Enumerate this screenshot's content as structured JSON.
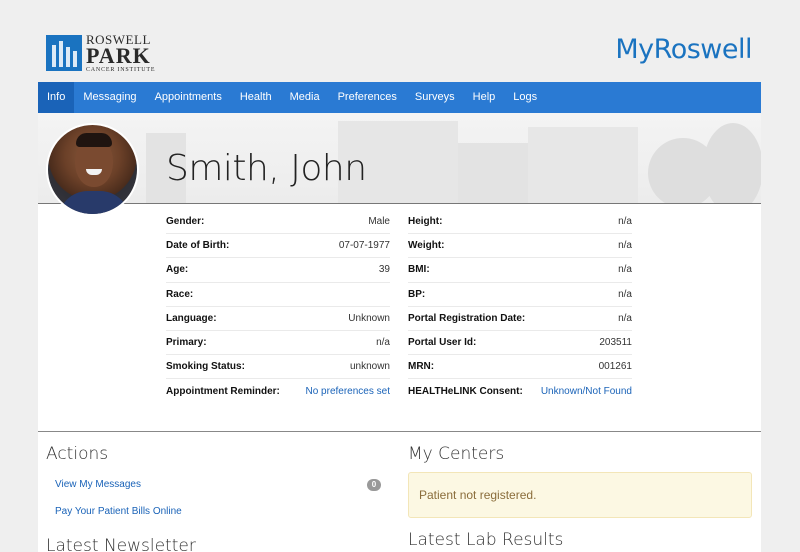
{
  "header": {
    "logo_line1": "ROSWELL",
    "logo_line2": "PARK",
    "logo_line3": "CANCER INSTITUTE",
    "brand_my": "My",
    "brand_name": "Roswell"
  },
  "nav": {
    "items": [
      {
        "label": "Info",
        "active": true
      },
      {
        "label": "Messaging"
      },
      {
        "label": "Appointments"
      },
      {
        "label": "Health"
      },
      {
        "label": "Media"
      },
      {
        "label": "Preferences"
      },
      {
        "label": "Surveys"
      },
      {
        "label": "Help"
      },
      {
        "label": "Logs"
      }
    ]
  },
  "patient": {
    "name": "Smith, John",
    "left": [
      {
        "label": "Gender:",
        "value": "Male"
      },
      {
        "label": "Date of Birth:",
        "value": "07-07-1977"
      },
      {
        "label": "Age:",
        "value": "39"
      },
      {
        "label": "Race:",
        "value": ""
      },
      {
        "label": "Language:",
        "value": "Unknown"
      },
      {
        "label": "Primary:",
        "value": "n/a"
      },
      {
        "label": "Smoking Status:",
        "value": "unknown"
      },
      {
        "label": "Appointment Reminder:",
        "value": "No preferences set"
      }
    ],
    "right": [
      {
        "label": "Height:",
        "value": "n/a"
      },
      {
        "label": "Weight:",
        "value": "n/a"
      },
      {
        "label": "BMI:",
        "value": "n/a"
      },
      {
        "label": "BP:",
        "value": "n/a"
      },
      {
        "label": "Portal Registration Date:",
        "value": "n/a"
      },
      {
        "label": "Portal User Id:",
        "value": "203511"
      },
      {
        "label": "MRN:",
        "value": "001261"
      },
      {
        "label": "HEALTHeLINK Consent:",
        "value": "Unknown/Not Found"
      }
    ]
  },
  "actions": {
    "title": "Actions",
    "view_messages": "View My Messages",
    "message_count": "0",
    "pay_bills": "Pay Your Patient Bills Online"
  },
  "newsletter": {
    "title": "Latest Newsletter"
  },
  "centers": {
    "title": "My Centers",
    "alert": "Patient not registered."
  },
  "lab": {
    "title": "Latest Lab Results"
  },
  "colors": {
    "accent": "#2a7ad3",
    "nav_active": "#1a63b8",
    "brand": "#1a73c0",
    "alert_bg": "#fcf8e3"
  }
}
